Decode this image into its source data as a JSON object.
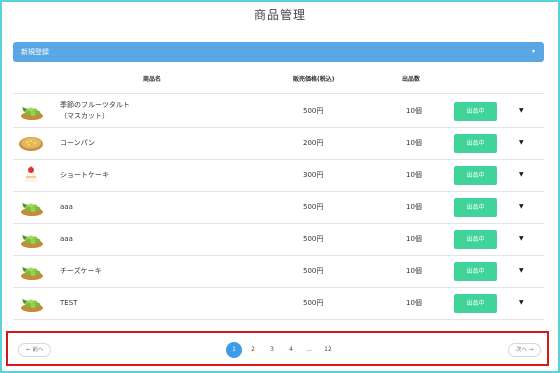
{
  "title": "商品管理",
  "new_bar": {
    "label": "新規登録",
    "caret": "▾"
  },
  "columns": {
    "name": "商品名",
    "price": "販売価格(税込)",
    "qty": "出品数"
  },
  "rows": [
    {
      "name_line1": "季節のフルーツタルト",
      "name_line2": "（マスカット）",
      "price": "500円",
      "qty": "10個",
      "status": "出品中",
      "thumb": "grape-tart"
    },
    {
      "name_line1": "コーンパン",
      "name_line2": "",
      "price": "200円",
      "qty": "10個",
      "status": "出品中",
      "thumb": "corn-bread"
    },
    {
      "name_line1": "ショートケーキ",
      "name_line2": "",
      "price": "300円",
      "qty": "10個",
      "status": "出品中",
      "thumb": "shortcake"
    },
    {
      "name_line1": "aaa",
      "name_line2": "",
      "price": "500円",
      "qty": "10個",
      "status": "出品中",
      "thumb": "grape-tart"
    },
    {
      "name_line1": "aaa",
      "name_line2": "",
      "price": "500円",
      "qty": "10個",
      "status": "出品中",
      "thumb": "grape-tart"
    },
    {
      "name_line1": "チーズケーキ",
      "name_line2": "",
      "price": "500円",
      "qty": "10個",
      "status": "出品中",
      "thumb": "grape-tart"
    },
    {
      "name_line1": "TEST",
      "name_line2": "",
      "price": "500円",
      "qty": "10個",
      "status": "出品中",
      "thumb": "grape-tart"
    }
  ],
  "pagination": {
    "prev": "← 前へ",
    "next": "次へ →",
    "pages": [
      "1",
      "2",
      "3",
      "4",
      "...",
      "12"
    ],
    "current": "1"
  },
  "colors": {
    "frame": "#5bd3d6",
    "accent": "#5aa7e6",
    "status": "#40d49b",
    "highlight": "#d11a1a",
    "active_page": "#3d9be9"
  }
}
